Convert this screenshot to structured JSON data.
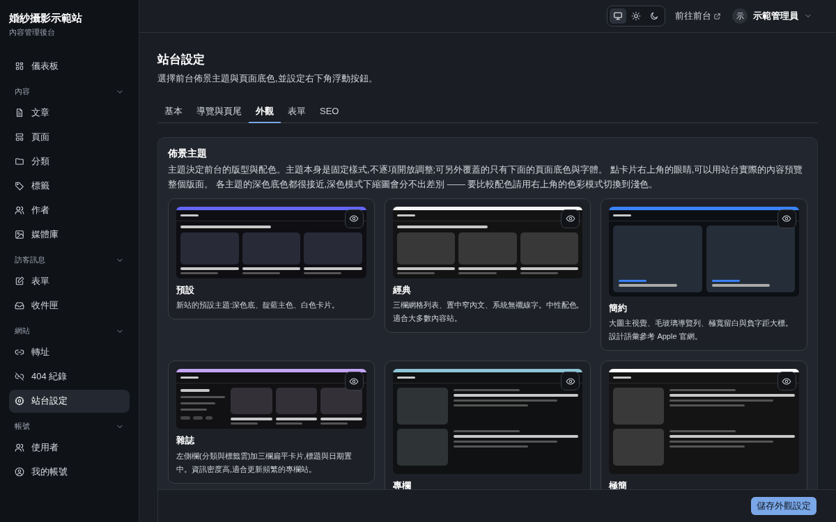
{
  "sidebar": {
    "site_name": "婚紗攝影示範站",
    "subtitle": "內容管理後台",
    "items": [
      {
        "label": "儀表板",
        "selected": false
      }
    ],
    "sections": [
      {
        "heading": "內容",
        "expanded": true,
        "items": [
          {
            "label": "文章",
            "selected": false
          },
          {
            "label": "頁面",
            "selected": false
          },
          {
            "label": "分類",
            "selected": false
          },
          {
            "label": "標籤",
            "selected": false
          },
          {
            "label": "作者",
            "selected": false
          },
          {
            "label": "媒體庫",
            "selected": false
          }
        ]
      },
      {
        "heading": "訪客訊息",
        "expanded": true,
        "items": [
          {
            "label": "表單",
            "selected": false
          },
          {
            "label": "收件匣",
            "selected": false
          }
        ]
      },
      {
        "heading": "網站",
        "expanded": true,
        "items": [
          {
            "label": "轉址",
            "selected": false
          },
          {
            "label": "404 紀錄",
            "selected": false
          },
          {
            "label": "站台設定",
            "selected": true
          }
        ]
      },
      {
        "heading": "帳號",
        "expanded": true,
        "items": [
          {
            "label": "使用者",
            "selected": false
          },
          {
            "label": "我的帳號",
            "selected": false
          }
        ]
      }
    ]
  },
  "topbar": {
    "theme_modes": [
      {
        "kind": "system",
        "selected": true
      },
      {
        "kind": "light",
        "selected": false
      },
      {
        "kind": "dark",
        "selected": false
      }
    ],
    "frontend_link": "前往前台",
    "avatar": "示",
    "user": "示範管理員"
  },
  "page": {
    "title": "站台設定",
    "description": "選擇前台佈景主題與頁面底色,並設定右下角浮動按鈕。",
    "tabs": [
      {
        "label": "基本",
        "selected": false
      },
      {
        "label": "導覽與頁尾",
        "selected": false
      },
      {
        "label": "外觀",
        "selected": true
      },
      {
        "label": "表單",
        "selected": false
      },
      {
        "label": "SEO",
        "selected": false
      }
    ]
  },
  "themes_panel": {
    "title": "佈景主題",
    "description": "主題決定前台的版型與配色。主題本身是固定樣式,不逐項開放調整;可另外覆蓋的只有下面的頁面底色與字體。 點卡片右上角的眼睛,可以用站台實際的內容預覽整個版面。 各主題的深色底色都很接近,深色模式下縮圖會分不出差別 —— 要比較配色請用右上角的色彩模式切換到淺色。",
    "themes": [
      {
        "name": "預設",
        "description": "新站的預設主題:深色底、靛藍主色、白色卡片。",
        "kind": "grid",
        "color": "#6366f1"
      },
      {
        "name": "經典",
        "description": "三欄網格列表、置中窄內文、系統無襯線字。中性配色,適合大多數內容站。",
        "kind": "grid",
        "color": "#f5f5f4"
      },
      {
        "name": "簡約",
        "description": "大圖主視覺、毛玻璃導覽列、極寬留白與負字距大標。設計語彙參考 Apple 官網。",
        "kind": "hero",
        "color": "#3b82f6"
      },
      {
        "name": "雜誌",
        "description": "左側欄(分類與標籤雲)加三欄扁平卡片,標題與日期置中。資訊密度高,適合更新頻繁的專欄站。",
        "kind": "magazine",
        "color": "#c4a5f5"
      },
      {
        "name": "專欄",
        "kind": "list",
        "color": "#8ec5d6"
      },
      {
        "name": "極簡",
        "kind": "list",
        "color": "#ffffff"
      }
    ]
  },
  "footer": {
    "save_button": "儲存外觀設定"
  }
}
